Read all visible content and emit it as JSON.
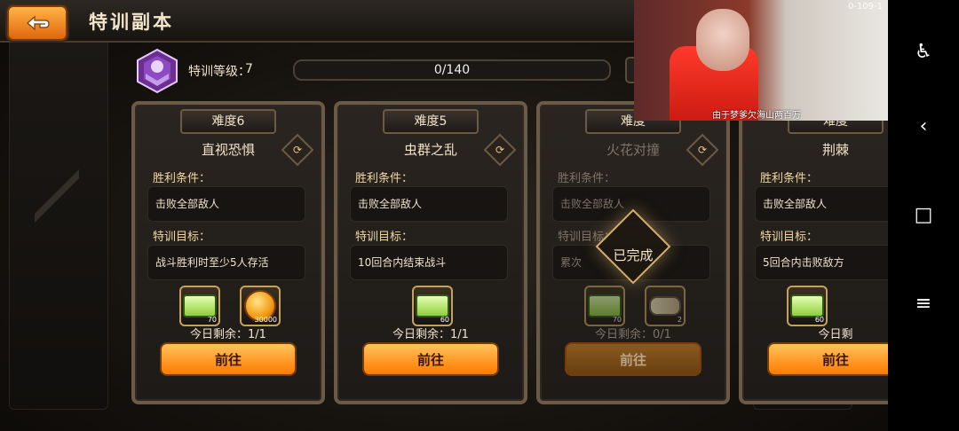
{
  "header": {
    "title": "特训副本"
  },
  "rank": {
    "label": "特训等级：",
    "value": "7"
  },
  "progress": {
    "text": "0/140",
    "fraction": 0
  },
  "cards": [
    {
      "difficulty": "难度6",
      "name": "直视恐惧",
      "victory_label": "胜利条件：",
      "victory": "击败全部敌人",
      "goal_label": "特训目标：",
      "goal": "战斗胜利时至少5人存活",
      "rewards": [
        {
          "icon": "ticket-icon",
          "count": "70"
        },
        {
          "icon": "coin-icon",
          "count": "30000"
        }
      ],
      "remain": "今日剩余：1/1",
      "button": "前往"
    },
    {
      "difficulty": "难度5",
      "name": "虫群之乱",
      "victory_label": "胜利条件：",
      "victory": "击败全部敌人",
      "goal_label": "特训目标：",
      "goal": "10回合内结束战斗",
      "rewards": [
        {
          "icon": "ticket-icon",
          "count": "60"
        }
      ],
      "remain": "今日剩余：1/1",
      "button": "前往"
    },
    {
      "difficulty": "难度",
      "name": "火花对撞",
      "victory_label": "胜利条件：",
      "victory": "击败全部敌人",
      "goal_label": "特训目标：",
      "goal": "累次",
      "rewards": [
        {
          "icon": "ticket-icon",
          "count": "70"
        },
        {
          "icon": "capsule-icon",
          "count": "2"
        }
      ],
      "remain": "今日剩余：0/1",
      "button": "前往",
      "status": "已完成"
    },
    {
      "difficulty": "难度",
      "name": "荆棘",
      "victory_label": "胜利条件：",
      "victory": "击败全部敌人",
      "goal_label": "特训目标：",
      "goal": "5回合内击败敌方",
      "rewards": [
        {
          "icon": "ticket-icon",
          "count": "60"
        }
      ],
      "remain": "今日剩",
      "button": "前往"
    }
  ],
  "video_overlay": {
    "caption": "由于梦爹欠海山两百万",
    "corner": "0-109-1"
  },
  "nav": {
    "icons": [
      "accessibility-icon",
      "back-triangle-icon",
      "home-square-icon",
      "menu-lines-icon"
    ]
  }
}
